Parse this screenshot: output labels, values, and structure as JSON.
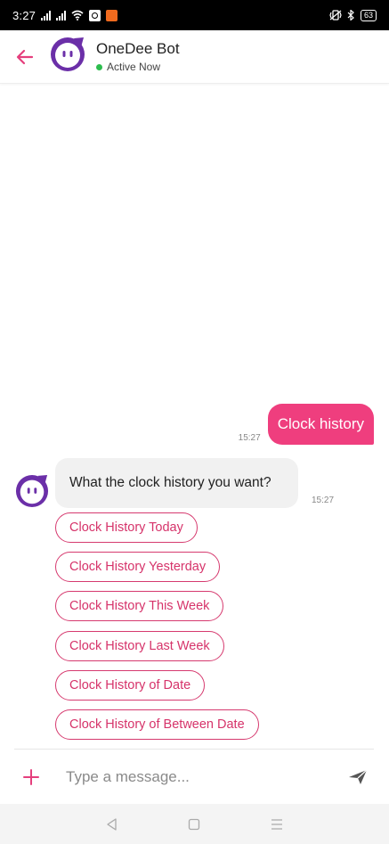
{
  "status_bar": {
    "time": "3:27",
    "battery": "63",
    "icons": [
      "signal-icon",
      "signal-icon",
      "wifi-icon",
      "app-icon",
      "app-icon",
      "vibrate-icon",
      "bluetooth-icon",
      "battery-icon"
    ]
  },
  "header": {
    "bot_name": "OneDee Bot",
    "status": "Active Now",
    "status_color": "#2dbd4e",
    "accent_color": "#e53f7d"
  },
  "chat": {
    "outgoing": {
      "text": "Clock history",
      "time": "15:27",
      "color": "#ef3e7e"
    },
    "incoming": {
      "text": "What the clock history you want?",
      "time": "15:27"
    },
    "quick_replies": [
      "Clock History Today",
      "Clock History Yesterday",
      "Clock History This Week",
      "Clock History Last Week",
      "Clock History of Date",
      "Clock History of Between Date"
    ]
  },
  "composer": {
    "placeholder": "Type a message..."
  }
}
